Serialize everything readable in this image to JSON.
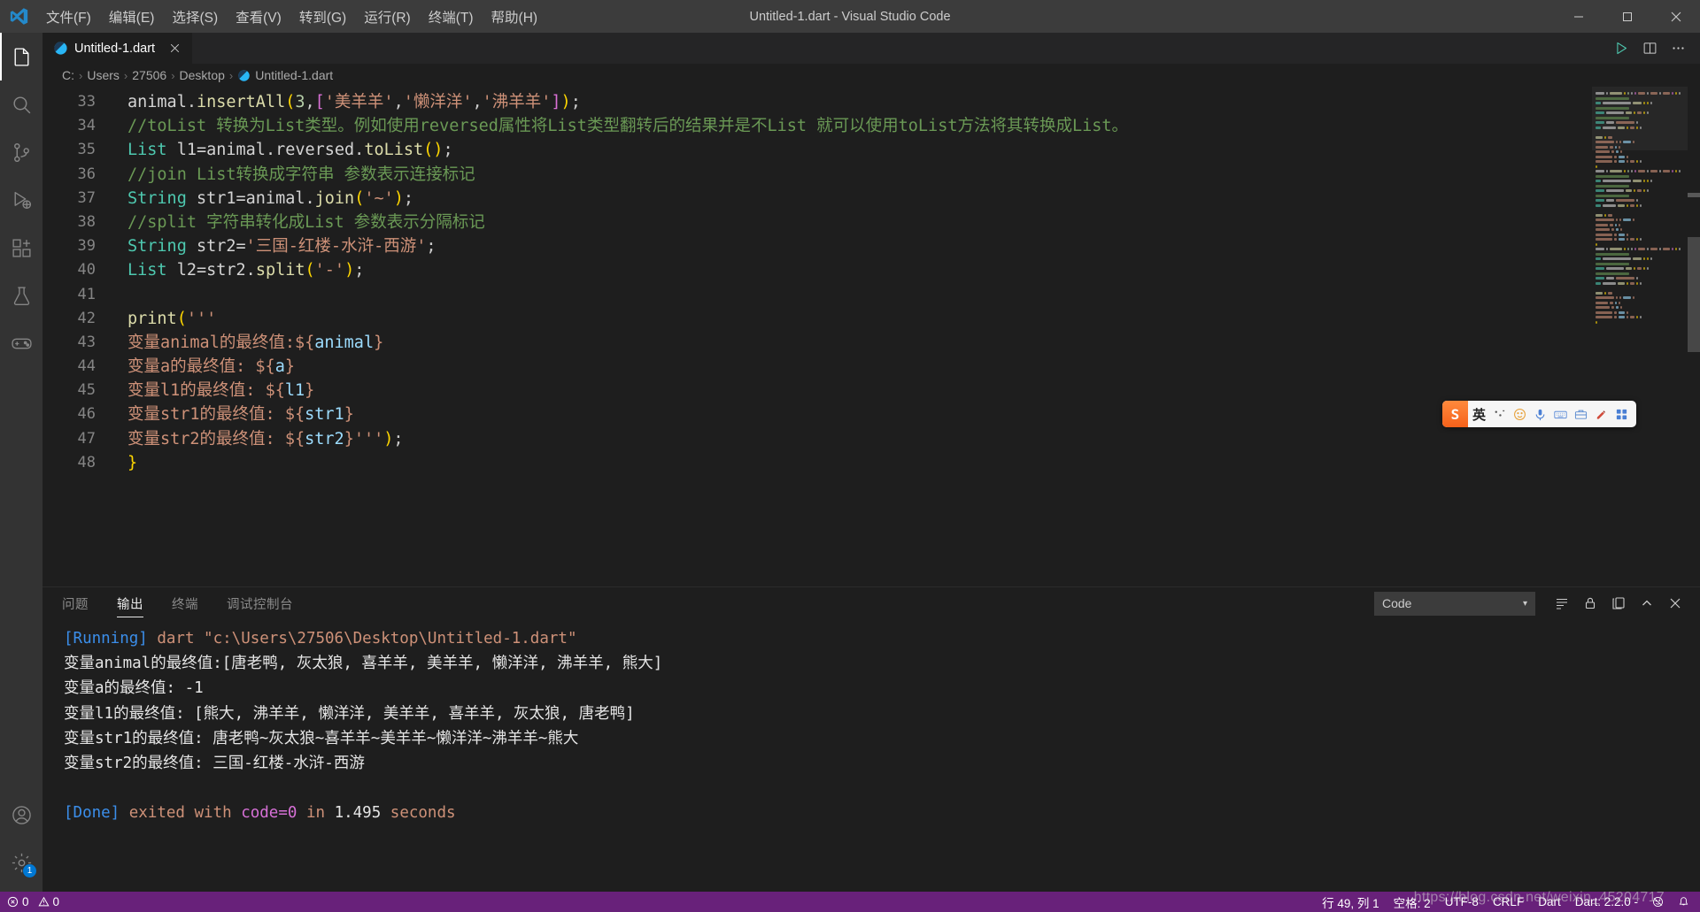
{
  "titlebar": {
    "logo_icon": "vscode-logo-icon",
    "window_title": "Untitled-1.dart - Visual Studio Code",
    "menus": [
      {
        "label": "文件(F)",
        "name": "menu-file"
      },
      {
        "label": "编辑(E)",
        "name": "menu-edit"
      },
      {
        "label": "选择(S)",
        "name": "menu-selection"
      },
      {
        "label": "查看(V)",
        "name": "menu-view"
      },
      {
        "label": "转到(G)",
        "name": "menu-go"
      },
      {
        "label": "运行(R)",
        "name": "menu-run"
      },
      {
        "label": "终端(T)",
        "name": "menu-terminal"
      },
      {
        "label": "帮助(H)",
        "name": "menu-help"
      }
    ],
    "window_controls": [
      "minimize",
      "maximize",
      "close"
    ]
  },
  "activitybar": {
    "items": [
      {
        "icon": "files-explorer-icon",
        "name": "activity-explorer",
        "active": true
      },
      {
        "icon": "search-icon",
        "name": "activity-search",
        "active": false
      },
      {
        "icon": "source-control-icon",
        "name": "activity-source-control",
        "active": false
      },
      {
        "icon": "run-debug-icon",
        "name": "activity-run-debug",
        "active": false
      },
      {
        "icon": "extensions-icon",
        "name": "activity-extensions",
        "active": false
      },
      {
        "icon": "testing-beaker-icon",
        "name": "activity-testing",
        "active": false
      },
      {
        "icon": "gamepad-icon",
        "name": "activity-gamepad",
        "active": false
      }
    ],
    "bottom": [
      {
        "icon": "account-icon",
        "name": "activity-account",
        "badge": ""
      },
      {
        "icon": "gear-icon",
        "name": "activity-settings",
        "badge": "1"
      }
    ]
  },
  "tabs": {
    "open": [
      {
        "label": "Untitled-1.dart",
        "icon": "dart-icon",
        "active": true,
        "close_icon": "close-icon"
      }
    ],
    "actions": [
      {
        "icon": "run-play-icon",
        "name": "run-code-button"
      },
      {
        "icon": "split-editor-icon",
        "name": "split-editor-button"
      },
      {
        "icon": "more-actions-icon",
        "name": "more-actions-button"
      }
    ]
  },
  "breadcrumb": {
    "items": [
      "C:",
      "Users",
      "27506",
      "Desktop",
      "Untitled-1.dart"
    ],
    "file_icon": "dart-icon",
    "separator": "›"
  },
  "editor": {
    "first_line_number": 33,
    "lines": [
      {
        "n": 33,
        "tokens": [
          {
            "t": "animal",
            "c": "t-plain"
          },
          {
            "t": ".",
            "c": "t-punc"
          },
          {
            "t": "insertAll",
            "c": "t-fn"
          },
          {
            "t": "(",
            "c": "t-brkt1"
          },
          {
            "t": "3",
            "c": "t-num"
          },
          {
            "t": ",",
            "c": "t-punc"
          },
          {
            "t": "[",
            "c": "t-brkt2"
          },
          {
            "t": "'美羊羊'",
            "c": "t-str"
          },
          {
            "t": ",",
            "c": "t-punc"
          },
          {
            "t": "'懒洋洋'",
            "c": "t-str"
          },
          {
            "t": ",",
            "c": "t-punc"
          },
          {
            "t": "'沸羊羊'",
            "c": "t-str"
          },
          {
            "t": "]",
            "c": "t-brkt2"
          },
          {
            "t": ")",
            "c": "t-brkt1"
          },
          {
            "t": ";",
            "c": "t-punc"
          }
        ]
      },
      {
        "n": 34,
        "tokens": [
          {
            "t": "//toList 转换为List类型。例如使用reversed属性将List类型翻转后的结果并是不List 就可以使用toList方法将其转换成List。",
            "c": "t-com"
          }
        ]
      },
      {
        "n": 35,
        "tokens": [
          {
            "t": "List",
            "c": "t-type"
          },
          {
            "t": " l1=animal.reversed.",
            "c": "t-plain"
          },
          {
            "t": "toList",
            "c": "t-fn"
          },
          {
            "t": "(",
            "c": "t-brkt1"
          },
          {
            "t": ")",
            "c": "t-brkt1"
          },
          {
            "t": ";",
            "c": "t-punc"
          }
        ]
      },
      {
        "n": 36,
        "tokens": [
          {
            "t": "//join List转换成字符串 参数表示连接标记",
            "c": "t-com"
          }
        ]
      },
      {
        "n": 37,
        "tokens": [
          {
            "t": "String",
            "c": "t-type"
          },
          {
            "t": " str1=animal.",
            "c": "t-plain"
          },
          {
            "t": "join",
            "c": "t-fn"
          },
          {
            "t": "(",
            "c": "t-brkt1"
          },
          {
            "t": "'~'",
            "c": "t-str"
          },
          {
            "t": ")",
            "c": "t-brkt1"
          },
          {
            "t": ";",
            "c": "t-punc"
          }
        ]
      },
      {
        "n": 38,
        "tokens": [
          {
            "t": "//split 字符串转化成List 参数表示分隔标记",
            "c": "t-com"
          }
        ]
      },
      {
        "n": 39,
        "tokens": [
          {
            "t": "String",
            "c": "t-type"
          },
          {
            "t": " str2=",
            "c": "t-plain"
          },
          {
            "t": "'三国-红楼-水浒-西游'",
            "c": "t-str"
          },
          {
            "t": ";",
            "c": "t-punc"
          }
        ]
      },
      {
        "n": 40,
        "tokens": [
          {
            "t": "List",
            "c": "t-type"
          },
          {
            "t": " l2=str2.",
            "c": "t-plain"
          },
          {
            "t": "split",
            "c": "t-fn"
          },
          {
            "t": "(",
            "c": "t-brkt1"
          },
          {
            "t": "'-'",
            "c": "t-str"
          },
          {
            "t": ")",
            "c": "t-brkt1"
          },
          {
            "t": ";",
            "c": "t-punc"
          }
        ]
      },
      {
        "n": 41,
        "tokens": []
      },
      {
        "n": 42,
        "tokens": [
          {
            "t": "print",
            "c": "t-fn"
          },
          {
            "t": "(",
            "c": "t-brkt1"
          },
          {
            "t": "'''",
            "c": "t-str"
          }
        ]
      },
      {
        "n": 43,
        "tokens": [
          {
            "t": "变量animal的最终值:",
            "c": "t-str"
          },
          {
            "t": "$",
            "c": "t-str"
          },
          {
            "t": "{",
            "c": "t-str"
          },
          {
            "t": "animal",
            "c": "t-var"
          },
          {
            "t": "}",
            "c": "t-str"
          }
        ]
      },
      {
        "n": 44,
        "tokens": [
          {
            "t": "变量a的最终值: ",
            "c": "t-str"
          },
          {
            "t": "${",
            "c": "t-str"
          },
          {
            "t": "a",
            "c": "t-var"
          },
          {
            "t": "}",
            "c": "t-str"
          }
        ]
      },
      {
        "n": 45,
        "tokens": [
          {
            "t": "变量l1的最终值: ",
            "c": "t-str"
          },
          {
            "t": "${",
            "c": "t-str"
          },
          {
            "t": "l1",
            "c": "t-var"
          },
          {
            "t": "}",
            "c": "t-str"
          }
        ]
      },
      {
        "n": 46,
        "tokens": [
          {
            "t": "变量str1的最终值: ",
            "c": "t-str"
          },
          {
            "t": "${",
            "c": "t-str"
          },
          {
            "t": "str1",
            "c": "t-var"
          },
          {
            "t": "}",
            "c": "t-str"
          }
        ]
      },
      {
        "n": 47,
        "tokens": [
          {
            "t": "变量str2的最终值: ",
            "c": "t-str"
          },
          {
            "t": "${",
            "c": "t-str"
          },
          {
            "t": "str2",
            "c": "t-var"
          },
          {
            "t": "}",
            "c": "t-str"
          },
          {
            "t": "'''",
            "c": "t-str"
          },
          {
            "t": ")",
            "c": "t-brkt1"
          },
          {
            "t": ";",
            "c": "t-punc"
          }
        ]
      },
      {
        "n": 48,
        "tokens": [
          {
            "t": "}",
            "c": "t-brkt1"
          }
        ]
      }
    ]
  },
  "ime": {
    "logo": "S",
    "mode_label": "英",
    "buttons": [
      "ime-logo-icon",
      "ime-mode-cn-icon",
      "ime-tone-icon",
      "ime-emoji-icon",
      "ime-voice-icon",
      "ime-keyboard-icon",
      "ime-toolbox-icon",
      "ime-skin-icon",
      "ime-apps-icon"
    ]
  },
  "panel": {
    "tabs": [
      {
        "label": "问题",
        "name": "panel-tab-problems",
        "active": false
      },
      {
        "label": "输出",
        "name": "panel-tab-output",
        "active": true
      },
      {
        "label": "终端",
        "name": "panel-tab-terminal",
        "active": false
      },
      {
        "label": "调试控制台",
        "name": "panel-tab-debug-console",
        "active": false
      }
    ],
    "channel_select": {
      "value": "Code",
      "chevron": "chevron-down-icon"
    },
    "actions": [
      {
        "icon": "clear-output-icon",
        "name": "clear-output-button"
      },
      {
        "icon": "lock-icon",
        "name": "lock-scroll-button"
      },
      {
        "icon": "open-settings-icon",
        "name": "open-output-settings-button"
      },
      {
        "icon": "chevron-up-icon",
        "name": "maximize-panel-button"
      },
      {
        "icon": "close-icon",
        "name": "close-panel-button"
      }
    ],
    "output_lines": [
      [
        {
          "t": "[Running]",
          "c": "o-blue"
        },
        {
          "t": " dart ",
          "c": "o-org"
        },
        {
          "t": "\"c:\\Users\\27506\\Desktop\\Untitled-1.dart\"",
          "c": "o-org"
        }
      ],
      [
        {
          "t": "变量animal的最终值:[唐老鸭, 灰太狼, 喜羊羊, 美羊羊, 懒洋洋, 沸羊羊, 熊大]",
          "c": "o-white"
        }
      ],
      [
        {
          "t": "变量a的最终值: -1",
          "c": "o-white"
        }
      ],
      [
        {
          "t": "变量l1的最终值: [熊大, 沸羊羊, 懒洋洋, 美羊羊, 喜羊羊, 灰太狼, 唐老鸭]",
          "c": "o-white"
        }
      ],
      [
        {
          "t": "变量str1的最终值: 唐老鸭~灰太狼~喜羊羊~美羊羊~懒洋洋~沸羊羊~熊大",
          "c": "o-white"
        }
      ],
      [
        {
          "t": "变量str2的最终值: 三国-红楼-水浒-西游",
          "c": "o-white"
        }
      ],
      [],
      [
        {
          "t": "[Done]",
          "c": "o-blue"
        },
        {
          "t": " exited with ",
          "c": "o-org"
        },
        {
          "t": "code=0",
          "c": "o-mag"
        },
        {
          "t": " in ",
          "c": "o-org"
        },
        {
          "t": "1.495",
          "c": "o-white"
        },
        {
          "t": " seconds",
          "c": "o-org"
        }
      ]
    ]
  },
  "statusbar": {
    "background": "#68217a",
    "left": [
      {
        "icon": "error-icon",
        "label": "0",
        "name": "status-errors"
      },
      {
        "icon": "warning-icon",
        "label": "0",
        "name": "status-warnings"
      }
    ],
    "right": [
      {
        "label": "行 49, 列 1",
        "name": "status-cursor-position"
      },
      {
        "label": "空格: 2",
        "name": "status-indentation"
      },
      {
        "label": "UTF-8",
        "name": "status-encoding"
      },
      {
        "label": "CRLF",
        "name": "status-eol"
      },
      {
        "label": "Dart",
        "name": "status-language-mode"
      },
      {
        "label": "Dart: 2.2.0 -",
        "name": "status-dart-version"
      },
      {
        "icon": "feedback-smiley-icon",
        "label": "",
        "name": "status-feedback"
      },
      {
        "icon": "bell-icon",
        "label": "",
        "name": "status-notifications"
      }
    ],
    "watermark": "https://blog.csdn.net/weixin_45204717"
  }
}
